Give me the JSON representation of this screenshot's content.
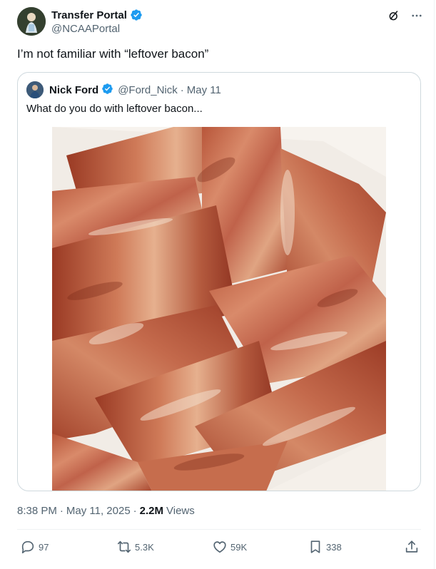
{
  "author": {
    "display_name": "Transfer Portal",
    "handle": "@NCAAPortal",
    "verified": true,
    "verified_color": "#1d9bf0"
  },
  "tweet": {
    "text": "I’m not familiar with “leftover bacon”"
  },
  "quoted": {
    "display_name": "Nick Ford",
    "handle": "@Ford_Nick",
    "separator": "·",
    "date": "May 11",
    "text": "What do you do with leftover bacon..."
  },
  "meta": {
    "time": "8:38 PM",
    "separator": "·",
    "date": "May 11, 2025",
    "separator2": "·",
    "views_count": "2.2M",
    "views_label": "Views"
  },
  "actions": {
    "replies": "97",
    "reposts": "5.3K",
    "likes": "59K",
    "bookmarks": "338"
  },
  "icons": [
    "grok-icon",
    "more-icon",
    "verified-badge-icon",
    "reply-icon",
    "repost-icon",
    "like-icon",
    "bookmark-icon",
    "share-icon"
  ],
  "colors": {
    "text_primary": "#0f1419",
    "text_secondary": "#536471",
    "border": "#cfd9de",
    "accent": "#1d9bf0"
  }
}
